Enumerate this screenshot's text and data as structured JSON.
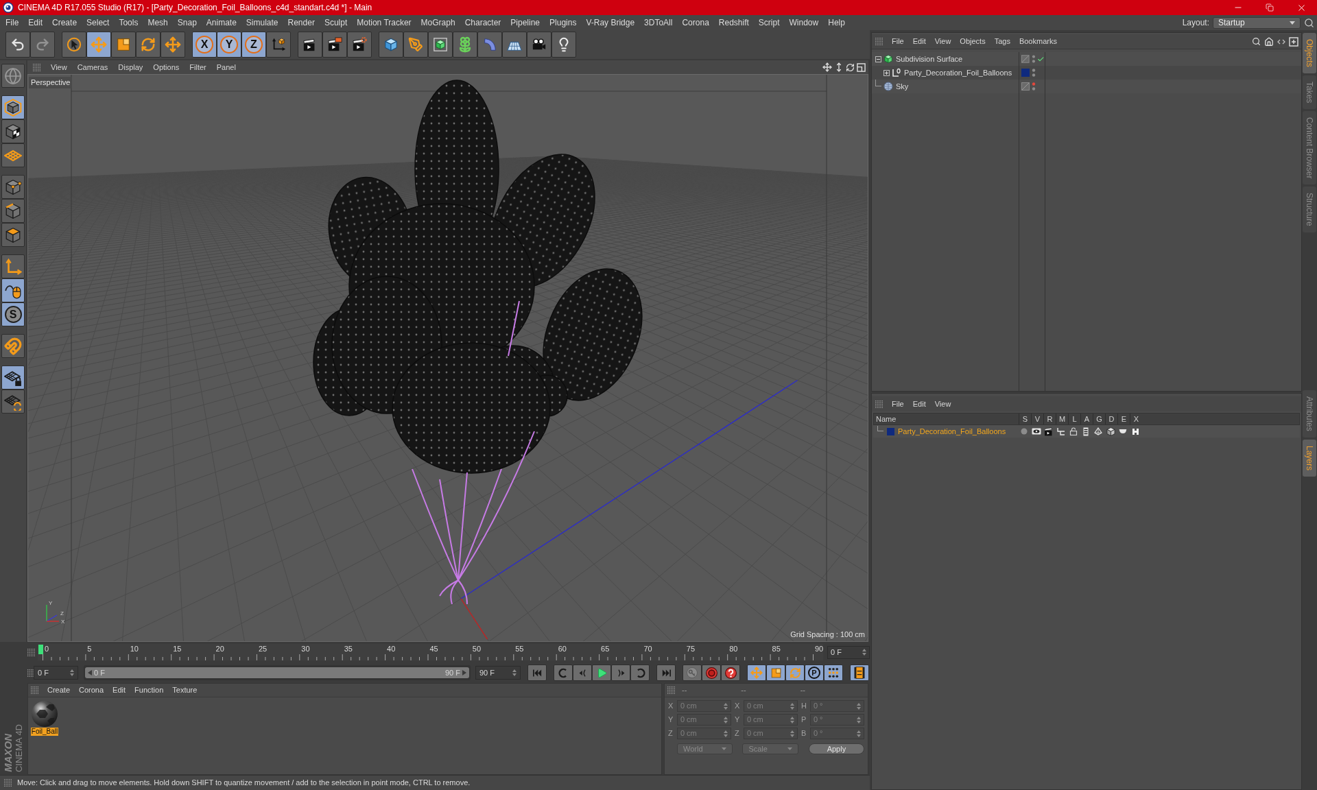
{
  "title_bar": {
    "title": "CINEMA 4D R17.055 Studio (R17) - [Party_Decoration_Foil_Balloons_c4d_standart.c4d *] - Main"
  },
  "menu_bar": {
    "items": [
      "File",
      "Edit",
      "Create",
      "Select",
      "Tools",
      "Mesh",
      "Snap",
      "Animate",
      "Simulate",
      "Render",
      "Sculpt",
      "Motion Tracker",
      "MoGraph",
      "Character",
      "Pipeline",
      "Plugins",
      "V-Ray Bridge",
      "3DToAll",
      "Corona",
      "Redshift",
      "Script",
      "Window",
      "Help"
    ],
    "layout_label": "Layout:",
    "layout_value": "Startup"
  },
  "toolbar": {
    "groups": [
      [
        {
          "kind": "undo",
          "active": false,
          "disabled": false
        },
        {
          "kind": "redo",
          "active": false,
          "disabled": true
        }
      ],
      [
        {
          "kind": "select",
          "active": false,
          "disabled": false
        },
        {
          "kind": "move",
          "active": true,
          "disabled": false
        },
        {
          "kind": "scale",
          "active": false,
          "disabled": false
        },
        {
          "kind": "rotate",
          "active": false,
          "disabled": false
        },
        {
          "kind": "move_last",
          "active": false,
          "disabled": false
        }
      ],
      [
        {
          "kind": "axis",
          "label": "X",
          "active": true,
          "disabled": false
        },
        {
          "kind": "axis",
          "label": "Y",
          "active": true,
          "disabled": false
        },
        {
          "kind": "axis",
          "label": "Z",
          "active": true,
          "disabled": false
        },
        {
          "kind": "coordinate_system",
          "active": false,
          "disabled": false
        }
      ],
      [
        {
          "kind": "render_view",
          "active": false,
          "disabled": false
        },
        {
          "kind": "render_picture",
          "active": false,
          "disabled": false
        },
        {
          "kind": "render_settings",
          "active": false,
          "disabled": false
        }
      ],
      [
        {
          "kind": "cube",
          "active": false,
          "disabled": false
        },
        {
          "kind": "pen",
          "active": false,
          "disabled": false
        },
        {
          "kind": "subdivision",
          "active": false,
          "disabled": false
        },
        {
          "kind": "cloner",
          "active": false,
          "disabled": false
        },
        {
          "kind": "deformer",
          "active": false,
          "disabled": false
        },
        {
          "kind": "floor",
          "active": false,
          "disabled": false
        },
        {
          "kind": "camera",
          "active": false,
          "disabled": false
        },
        {
          "kind": "light",
          "active": false,
          "disabled": false
        }
      ]
    ]
  },
  "mode_toolbar": {
    "groups": [
      [
        {
          "kind": "convert",
          "active": false
        }
      ],
      [
        {
          "kind": "model",
          "active": true
        },
        {
          "kind": "texture",
          "active": false
        },
        {
          "kind": "workplane",
          "active": false
        }
      ],
      [
        {
          "kind": "points",
          "active": false
        },
        {
          "kind": "edges",
          "active": false
        },
        {
          "kind": "polygons",
          "active": false
        }
      ],
      [
        {
          "kind": "axis_mode",
          "active": false
        },
        {
          "kind": "tweak",
          "active": true
        },
        {
          "kind": "solo",
          "label": "S",
          "active": true
        }
      ],
      [
        {
          "kind": "snap",
          "active": false
        }
      ],
      [
        {
          "kind": "workplane_lock",
          "active": true
        },
        {
          "kind": "workplane_align",
          "active": false
        }
      ]
    ]
  },
  "viewport": {
    "menu": [
      "View",
      "Cameras",
      "Display",
      "Options",
      "Filter",
      "Panel"
    ],
    "camera": "Perspective",
    "grid_spacing": "Grid Spacing : 100 cm",
    "axis_labels": [
      "Y",
      "Z",
      "X"
    ]
  },
  "timeline": {
    "ticks": [
      "0",
      "5",
      "10",
      "15",
      "20",
      "25",
      "30",
      "35",
      "40",
      "45",
      "50",
      "55",
      "60",
      "65",
      "70",
      "75",
      "80",
      "85",
      "90"
    ],
    "playhead": {
      "level": 0
    },
    "current_frame": "0 F"
  },
  "playback": {
    "start_field": "0 F",
    "range": {
      "start": "0 F",
      "end": "90 F",
      "level": 1
    },
    "end_field": "90 F",
    "groups": [
      [
        {
          "kind": "first_frame",
          "active": false
        }
      ],
      [
        {
          "kind": "previous_key",
          "active": false
        },
        {
          "kind": "previous_frame",
          "active": false
        },
        {
          "kind": "play",
          "active": false
        },
        {
          "kind": "next_frame",
          "active": false
        },
        {
          "kind": "next_key",
          "active": false
        }
      ],
      [
        {
          "kind": "last_frame",
          "active": false
        }
      ],
      [
        {
          "kind": "keyframe_selection",
          "active": false
        },
        {
          "kind": "record",
          "active": false
        },
        {
          "kind": "autokey",
          "active": false
        }
      ],
      [
        {
          "kind": "position_key",
          "active": true
        },
        {
          "kind": "scale_key",
          "active": true
        },
        {
          "kind": "rotation_key",
          "active": true
        },
        {
          "kind": "parameter",
          "label": "P",
          "active": true
        },
        {
          "kind": "point_level",
          "active": true
        }
      ],
      [
        {
          "kind": "timeline",
          "active": true
        }
      ]
    ]
  },
  "logo": {
    "brand": "MAXON",
    "product": "CINEMA 4D"
  },
  "material_manager": {
    "menu": [
      "Create",
      "Corona",
      "Edit",
      "Function",
      "Texture"
    ],
    "materials": [
      {
        "name": "Foil_Ball",
        "selected": true
      }
    ]
  },
  "coordinates": {
    "headers": [
      "--",
      "--",
      "--"
    ],
    "rows": [
      {
        "position_axis": "X",
        "position": "0 cm",
        "size_axis": "X",
        "size": "0 cm",
        "rotation_axis": "H",
        "rotation": "0 °"
      },
      {
        "position_axis": "Y",
        "position": "0 cm",
        "size_axis": "Y",
        "size": "0 cm",
        "rotation_axis": "P",
        "rotation": "0 °"
      },
      {
        "position_axis": "Z",
        "position": "0 cm",
        "size_axis": "Z",
        "size": "0 cm",
        "rotation_axis": "B",
        "rotation": "0 °"
      }
    ],
    "coordinate_mode": "World",
    "transform_mode": "Scale",
    "apply_label": "Apply"
  },
  "status_bar": {
    "text": "Move: Click and drag to move elements. Hold down SHIFT to quantize movement / add to the selection in point mode, CTRL to remove."
  },
  "object_manager": {
    "menu": [
      "File",
      "Edit",
      "View",
      "Objects",
      "Tags",
      "Bookmarks"
    ],
    "tree": [
      {
        "name": "Subdivision Surface",
        "kind": "subdivision",
        "expanded": true,
        "editor_visible": true,
        "enabled": true,
        "children": [
          {
            "name": "Party_Decoration_Foil_Balloons",
            "kind": "null",
            "expanded": false,
            "editor_visible": true,
            "color": "#0f2a7e"
          }
        ]
      },
      {
        "name": "Sky",
        "kind": "sky",
        "editor_visible": false
      }
    ]
  },
  "layer_manager": {
    "menu": [
      "File",
      "Edit",
      "View"
    ],
    "columns": [
      "Name",
      "S",
      "V",
      "R",
      "M",
      "L",
      "A",
      "G",
      "D",
      "E",
      "X"
    ],
    "layers": [
      {
        "name": "Party_Decoration_Foil_Balloons",
        "color": "#0f2a7e",
        "selected": true
      }
    ]
  },
  "side_tabs": {
    "upper": [
      {
        "label": "Objects",
        "selected": true
      },
      {
        "label": "Takes",
        "selected": false
      },
      {
        "label": "Content Browser",
        "selected": false
      },
      {
        "label": "Structure",
        "selected": false
      }
    ],
    "lower": [
      {
        "label": "Attributes",
        "selected": false
      },
      {
        "label": "Layers",
        "selected": true
      }
    ]
  }
}
